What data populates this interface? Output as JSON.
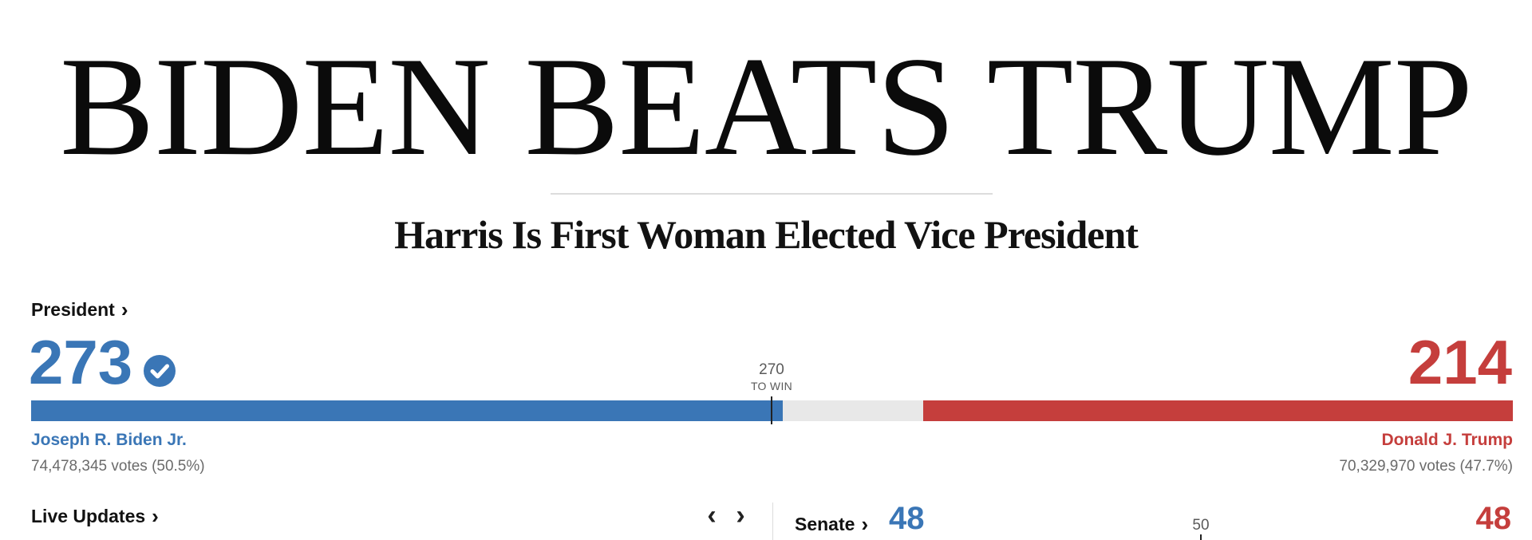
{
  "headline": "BIDEN BEATS TRUMP",
  "subheadline": "Harris Is First Woman Elected Vice President",
  "president": {
    "section_label": "President",
    "chevron": "›",
    "threshold": "270",
    "threshold_label": "TO WIN",
    "electoral_total": 538,
    "dem": {
      "electoral_votes": "273",
      "electoral_votes_value": 273,
      "winner_check_icon": "check-circle-icon",
      "name": "Joseph R. Biden Jr.",
      "votes": "74,478,345 votes (50.5%)",
      "color": "#3a76b6"
    },
    "rep": {
      "electoral_votes": "214",
      "electoral_votes_value": 214,
      "name": "Donald J. Trump",
      "votes": "70,329,970 votes (47.7%)",
      "color": "#c53e3c"
    }
  },
  "live_updates": {
    "label": "Live Updates",
    "chevron": "›",
    "prev_arrow": "‹",
    "next_arrow": "›"
  },
  "senate": {
    "label": "Senate",
    "chevron": "›",
    "dem_seats": "48",
    "rep_seats": "48",
    "threshold": "50"
  },
  "colors": {
    "dem": "#3a76b6",
    "rep": "#c53e3c",
    "uncalled": "#e8e8e8"
  }
}
